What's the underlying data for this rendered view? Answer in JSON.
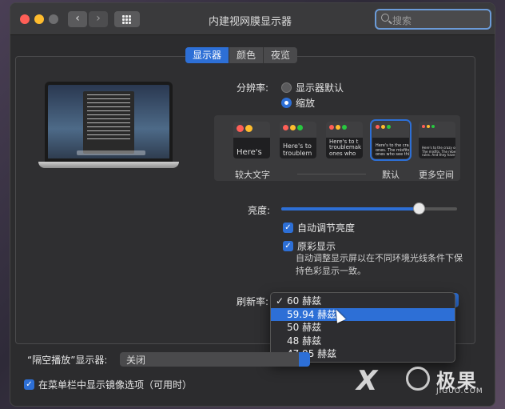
{
  "window": {
    "title": "内建视网膜显示器"
  },
  "search": {
    "placeholder": "搜索"
  },
  "tabs": [
    {
      "label": "显示器",
      "active": true
    },
    {
      "label": "颜色"
    },
    {
      "label": "夜览"
    }
  ],
  "resolution": {
    "label": "分辨率:",
    "options": [
      {
        "label": "显示器默认",
        "selected": false
      },
      {
        "label": "缩放",
        "selected": true
      }
    ]
  },
  "scale_options": [
    {
      "sample": "Here's",
      "caption": "较大文字"
    },
    {
      "sample": "Here's to\ntroublem",
      "caption": ""
    },
    {
      "sample": "Here's to t\ntroublemak\nones who",
      "caption": ""
    },
    {
      "sample": "Here's to the crazy\nones. The misfits.\nones who see things",
      "caption": "默认",
      "selected": true
    },
    {
      "sample": "Here's to the crazy ones\nThe misfits. The rebels.\nrules. And they have",
      "caption": "更多空间"
    }
  ],
  "brightness": {
    "label": "亮度:",
    "value": 0.78
  },
  "checkboxes": [
    {
      "label": "自动调节亮度",
      "checked": true
    },
    {
      "label": "原彩显示",
      "checked": true
    }
  ],
  "true_tone_note": "自动调整显示屏以在不同环境光线条件下保持色彩显示一致。",
  "refresh_rate": {
    "label": "刷新率:",
    "options": [
      {
        "label": "60 赫兹",
        "checked": true
      },
      {
        "label": "59.94 赫兹",
        "highlighted": true
      },
      {
        "label": "50 赫兹"
      },
      {
        "label": "48 赫兹"
      },
      {
        "label": "47.95 赫兹"
      }
    ]
  },
  "airplay": {
    "label": "“隔空播放”显示器:",
    "value": "关闭"
  },
  "mirror_option": {
    "label": "在菜单栏中显示镜像选项（可用时）",
    "checked": true
  },
  "watermark": {
    "brand": "极果",
    "url": "JIGUO.COM"
  },
  "colors": {
    "accent": "#2d6fd6",
    "close": "#ff5f57",
    "minimize": "#febc2e",
    "zoom": "#6e6e70"
  }
}
